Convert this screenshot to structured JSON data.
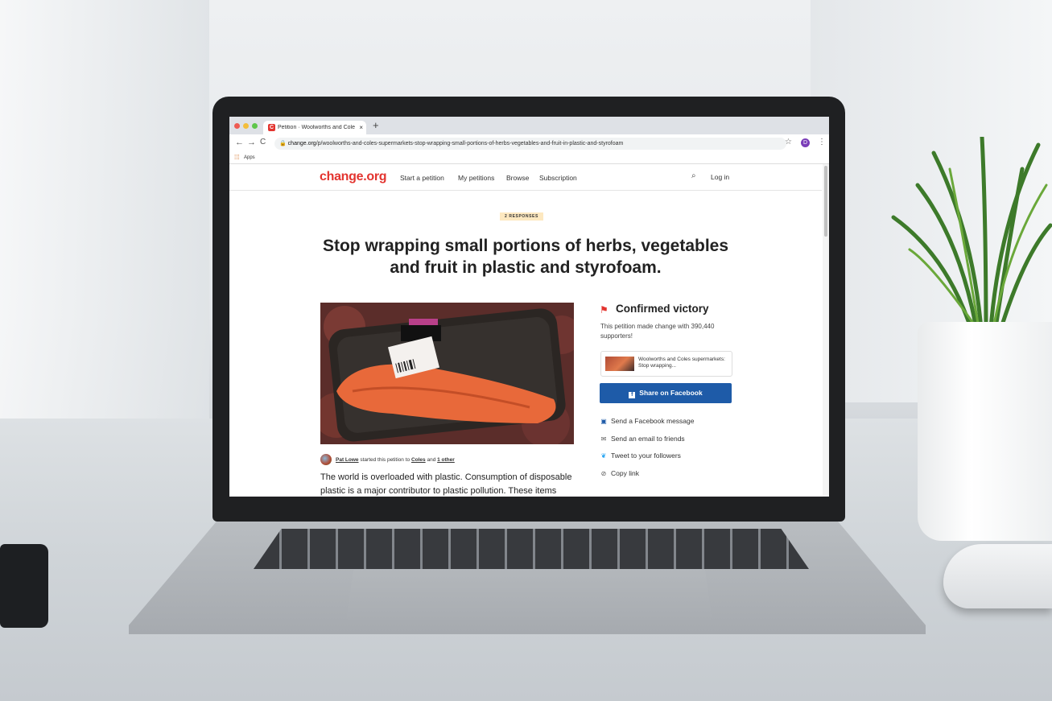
{
  "browser": {
    "tab_title": "Petition · Woolworths and Cole",
    "tab_close": "×",
    "new_tab": "+",
    "favicon_letter": "C",
    "url_domain": "change.org",
    "url_path": "/p/woolworths-and-coles-supermarkets-stop-wrapping-small-portions-of-herbs-vegetables-and-fruit-in-plastic-and-styrofoam",
    "bookmarks_label": "Apps",
    "profile_initial": "D"
  },
  "header": {
    "logo": "change.org",
    "nav": [
      "Start a petition",
      "My petitions",
      "Browse",
      "Subscription"
    ],
    "login": "Log in"
  },
  "petition": {
    "badge": "2 RESPONSES",
    "title": "Stop wrapping small portions of herbs, vegetables and fruit in plastic and styrofoam.",
    "author_name": "Pat Lowe",
    "author_mid": " started this petition to ",
    "target": "Coles",
    "author_and": " and ",
    "others": "1 other",
    "body": "The world is overloaded with plastic. Consumption of disposable plastic is a major contributor to plastic pollution. These items"
  },
  "sidebar": {
    "status": "Confirmed victory",
    "description": "This petition made change with 390,440 supporters!",
    "card_title": "Woolworths and Coles supermarkets: Stop wrapping...",
    "facebook_button": "Share on Facebook",
    "share_options": [
      "Send a Facebook message",
      "Send an email to friends",
      "Tweet to your followers",
      "Copy link"
    ]
  },
  "colors": {
    "brand": "#e3342f",
    "facebook": "#1e5ba8",
    "badge_bg": "#fde8c0"
  }
}
